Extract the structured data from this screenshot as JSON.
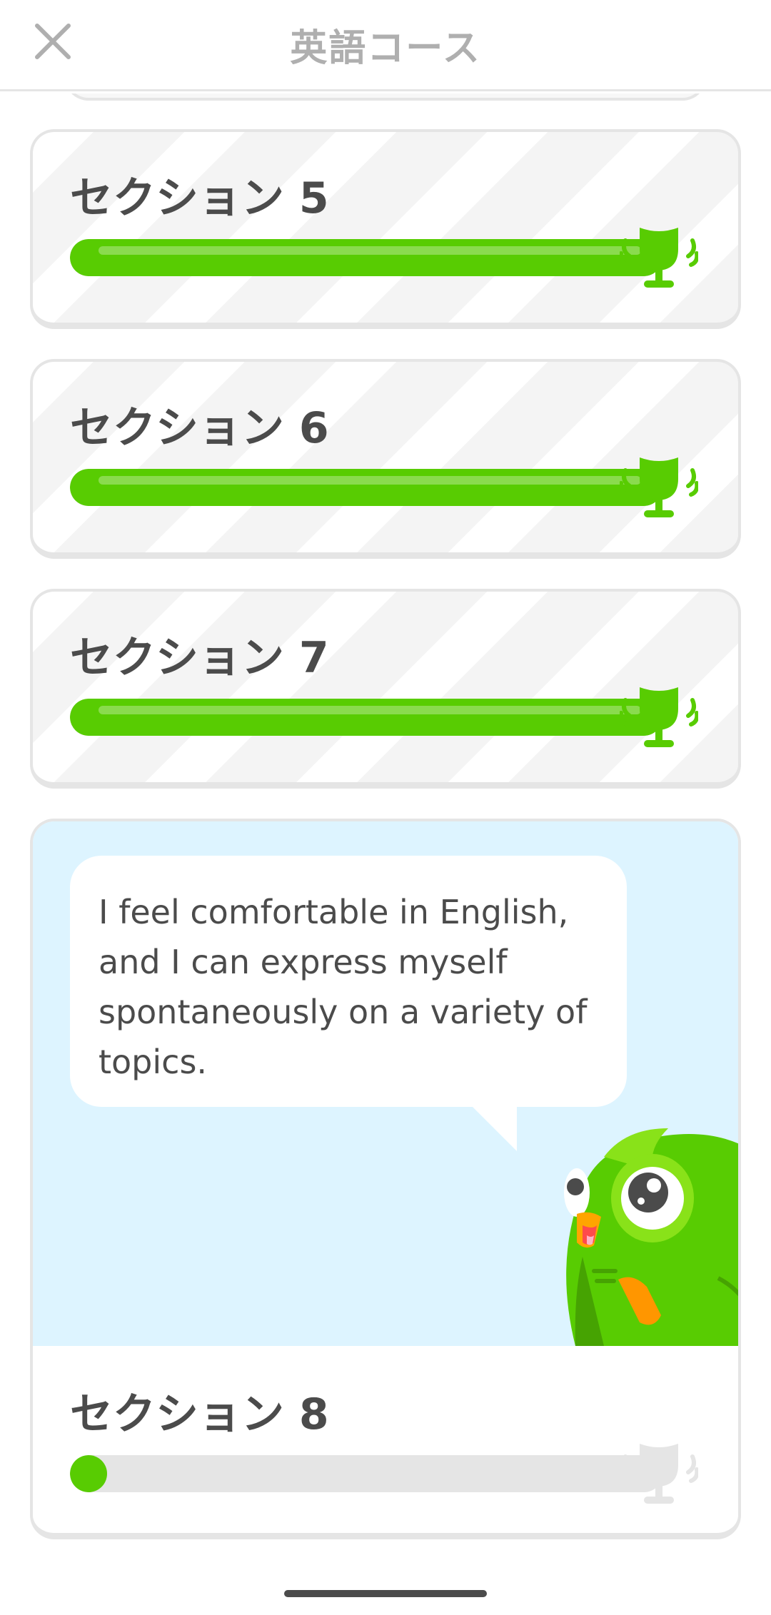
{
  "header": {
    "title": "英語コース",
    "close_icon": "close-icon"
  },
  "sections": [
    {
      "label": "セクション 5",
      "progress": 1.0,
      "status": "completed",
      "trophy_icon": "trophy-icon"
    },
    {
      "label": "セクション 6",
      "progress": 1.0,
      "status": "completed",
      "trophy_icon": "trophy-icon"
    },
    {
      "label": "セクション 7",
      "progress": 1.0,
      "status": "completed",
      "trophy_icon": "trophy-icon"
    }
  ],
  "current_section": {
    "label": "セクション 8",
    "progress": 0.0,
    "status": "current",
    "speech": "I feel comfortable in English, and I can express myself spontaneously on a variety of topics.",
    "mascot_icon": "owl-mascot-icon",
    "trophy_icon": "trophy-icon"
  },
  "colors": {
    "accent_green": "#58cc02",
    "track_gray": "#e5e5e5",
    "hero_blue": "#ddf4ff",
    "text_dark": "#4b4b4b",
    "title_gray": "#afafaf"
  }
}
